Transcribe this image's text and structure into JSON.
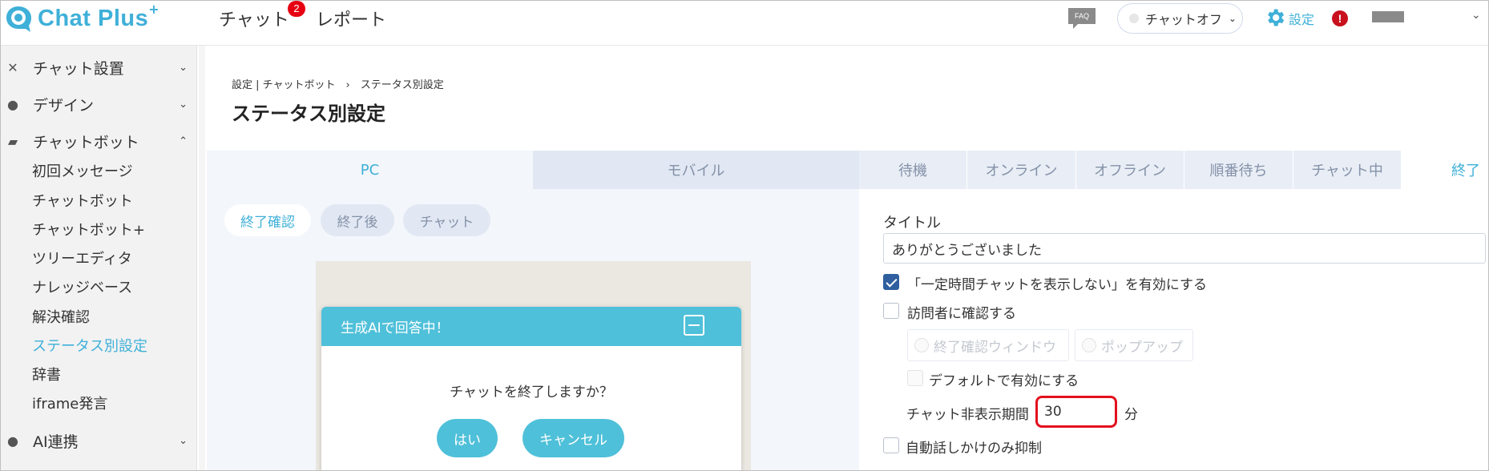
{
  "header": {
    "logo_text": "Chat Plus",
    "logo_plus": "+",
    "nav_chat": "チャット",
    "nav_chat_badge": "2",
    "nav_report": "レポート",
    "faq_label": "FAQ",
    "status_label": "チャットオフ",
    "settings_label": "設定",
    "alert_label": "!"
  },
  "sidebar": {
    "sections": [
      {
        "label": "チャット設置",
        "icon": "tools-icon"
      },
      {
        "label": "デザイン",
        "icon": "palette-icon"
      },
      {
        "label": "チャットボット",
        "icon": "chat-bubbles-icon"
      }
    ],
    "subitems": [
      "初回メッセージ",
      "チャットボット",
      "チャットボット+",
      "ツリーエディタ",
      "ナレッジベース",
      "解決確認",
      "ステータス別設定",
      "辞書",
      "iframe発言"
    ],
    "active_subitem": "ステータス別設定",
    "ai_section": "AI連携"
  },
  "page": {
    "breadcrumb": "設定 | チャットボット　›　ステータス別設定",
    "title": "ステータス別設定"
  },
  "device_tabs": [
    "PC",
    "モバイル"
  ],
  "preview_tabs": [
    "終了確認",
    "終了後",
    "チャット"
  ],
  "chat_preview": {
    "header": "生成AIで回答中！",
    "question": "チャットを終了しますか？",
    "yes": "はい",
    "cancel": "キャンセル"
  },
  "state_tabs": [
    "待機",
    "オンライン",
    "オフライン",
    "順番待ち",
    "チャット中",
    "終了"
  ],
  "settings": {
    "title_label": "タイトル",
    "title_value": "ありがとうございました",
    "hide_chat_checkbox": "「一定時間チャットを表示しない」を有効にする",
    "hide_chat_checked": true,
    "confirm_visitor": "訪問者に確認する",
    "radio_window": "終了確認ウィンドウ",
    "radio_popup": "ポップアップ",
    "default_enabled": "デフォルトで有効にする",
    "period_label": "チャット非表示期間",
    "period_value": "30",
    "period_unit": "分",
    "auto_suppress": "自動話しかけのみ抑制"
  },
  "colors": {
    "brand": "#3fb0d8",
    "chat_header": "#4fc0d9",
    "highlight_border": "#e3101e"
  }
}
